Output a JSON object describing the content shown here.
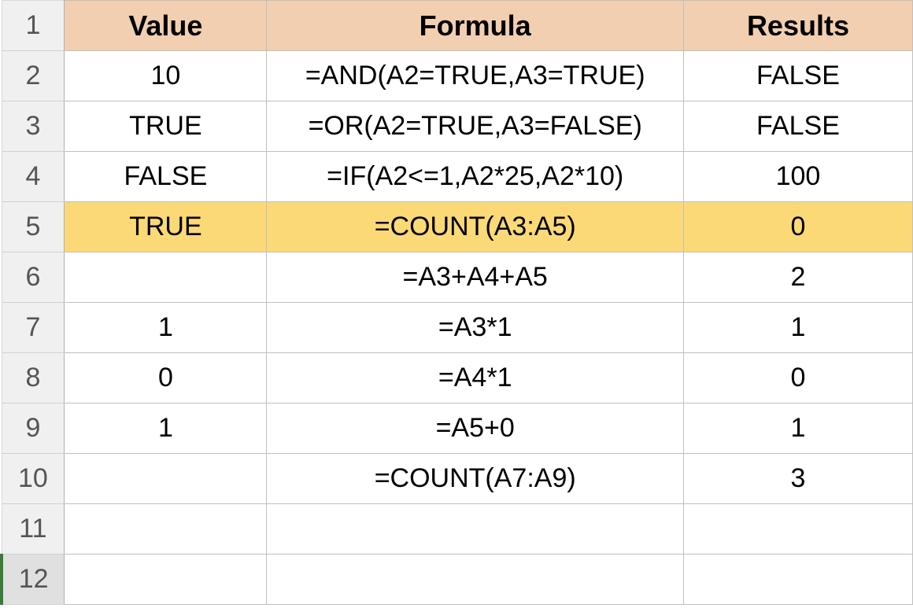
{
  "headers": {
    "value": "Value",
    "formula": "Formula",
    "results": "Results"
  },
  "rows": [
    {
      "num": "1",
      "value": "",
      "formula": "",
      "results": ""
    },
    {
      "num": "2",
      "value": "10",
      "formula": "=AND(A2=TRUE,A3=TRUE)",
      "results": "FALSE"
    },
    {
      "num": "3",
      "value": "TRUE",
      "formula": "=OR(A2=TRUE,A3=FALSE)",
      "results": "FALSE"
    },
    {
      "num": "4",
      "value": "FALSE",
      "formula": "=IF(A2<=1,A2*25,A2*10)",
      "results": "100"
    },
    {
      "num": "5",
      "value": "TRUE",
      "formula": "=COUNT(A3:A5)",
      "results": "0"
    },
    {
      "num": "6",
      "value": "",
      "formula": "=A3+A4+A5",
      "results": "2"
    },
    {
      "num": "7",
      "value": "1",
      "formula": "=A3*1",
      "results": "1"
    },
    {
      "num": "8",
      "value": "0",
      "formula": "=A4*1",
      "results": "0"
    },
    {
      "num": "9",
      "value": "1",
      "formula": "=A5+0",
      "results": "1"
    },
    {
      "num": "10",
      "value": "",
      "formula": "=COUNT(A7:A9)",
      "results": "3"
    },
    {
      "num": "11",
      "value": "",
      "formula": "",
      "results": ""
    },
    {
      "num": "12",
      "value": "",
      "formula": "",
      "results": ""
    }
  ],
  "highlighted_row": "5",
  "selected_row": "12"
}
